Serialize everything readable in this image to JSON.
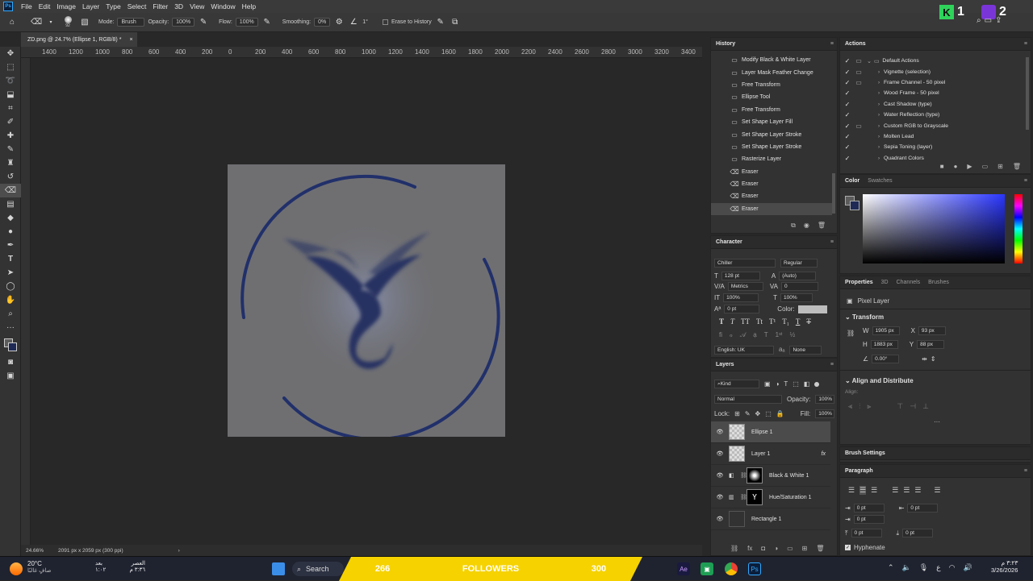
{
  "app": {
    "logo": "Ps"
  },
  "menu": [
    "File",
    "Edit",
    "Image",
    "Layer",
    "Type",
    "Select",
    "Filter",
    "3D",
    "View",
    "Window",
    "Help"
  ],
  "options": {
    "brush_size": "92",
    "mode_label": "Mode:",
    "mode_value": "Brush",
    "opacity_label": "Opacity:",
    "opacity_value": "100%",
    "flow_label": "Flow:",
    "flow_value": "100%",
    "smoothing_label": "Smoothing:",
    "smoothing_value": "0%",
    "angle_value": "1°",
    "erase_history": "Erase to History"
  },
  "overlay": {
    "score_left": "1",
    "score_right": "2"
  },
  "document": {
    "tab_title": "ZD.png @ 24.7% (Ellipse 1, RGB/8) *",
    "tab_close": "×"
  },
  "ruler_labels": [
    "1400",
    "1200",
    "1000",
    "800",
    "600",
    "400",
    "200",
    "0",
    "200",
    "400",
    "600",
    "800",
    "1000",
    "1200",
    "1400",
    "1600",
    "1800",
    "2000",
    "2200",
    "2400",
    "2600",
    "2800",
    "3000",
    "3200",
    "3400"
  ],
  "status": {
    "zoom": "24.66%",
    "doc_size": "2091 px x 2059 px (300 ppi)",
    "arrow": "›"
  },
  "history": {
    "title": "History",
    "items": [
      "Modify Black & White Layer",
      "Layer Mask Feather Change",
      "Free Transform",
      "Ellipse Tool",
      "Free Transform",
      "Set Shape Layer Fill",
      "Set Shape Layer Stroke",
      "Set Shape Layer Stroke",
      "Rasterize Layer",
      "Eraser",
      "Eraser",
      "Eraser",
      "Eraser"
    ]
  },
  "actions": {
    "title": "Actions",
    "items": [
      "Default Actions",
      "Vignette (selection)",
      "Frame Channel - 50 pixel",
      "Wood Frame - 50 pixel",
      "Cast Shadow (type)",
      "Water Reflection (type)",
      "Custom RGB to Grayscale",
      "Molten Lead",
      "Sepia Toning (layer)",
      "Quadrant Colors"
    ]
  },
  "color": {
    "tab_active": "Color",
    "tab_inactive": "Swatches",
    "hue_top": "#2a36ff"
  },
  "character": {
    "title": "Character",
    "font": "Chiller",
    "style": "Regular",
    "size": "128 pt",
    "leading": "(Auto)",
    "kerning": "Metrics",
    "tracking": "0",
    "vscale": "100%",
    "hscale": "100%",
    "baseline": "0 pt",
    "color_label": "Color:",
    "language": "English: UK",
    "aa": "None"
  },
  "properties": {
    "tabs": [
      "Properties",
      "3D",
      "Channels",
      "Brushes"
    ],
    "kind": "Pixel Layer",
    "transform_label": "Transform",
    "w_label": "W",
    "w": "1905 px",
    "x_label": "X",
    "x": "93 px",
    "h_label": "H",
    "h": "1883 px",
    "y_label": "Y",
    "y": "88 px",
    "angle": "0.00°",
    "align_label": "Align and Distribute",
    "align_sub": "Align:",
    "more": "···"
  },
  "layers": {
    "title": "Layers",
    "kind": "Kind",
    "blend": "Normal",
    "opacity_label": "Opacity:",
    "opacity": "100%",
    "lock_label": "Lock:",
    "fill_label": "Fill:",
    "fill": "100%",
    "fx": "fx",
    "items": [
      "Ellipse 1",
      "Layer 1",
      "Black & White 1",
      "Hue/Saturation 1",
      "Rectangle 1"
    ]
  },
  "brush_settings": {
    "title": "Brush Settings"
  },
  "paragraph": {
    "title": "Paragraph",
    "indent_left": "0 pt",
    "indent_right": "0 pt",
    "first_line": "0 pt",
    "space_before": "0 pt",
    "space_after": "0 pt",
    "hyphenate": "Hyphenate"
  },
  "taskbar": {
    "weather_temp": "20°C",
    "weather_desc": "صافٍ غالبًا",
    "prayer_label": "العصر",
    "prayer_in": "بعد",
    "prayer_time": "٣:٣٦ م",
    "prayer_left": "١:٠٢",
    "search": "Search",
    "banner_left": "266",
    "banner_mid": "FOLLOWERS",
    "banner_right": "300",
    "time": "٣:٢٣ م",
    "date": "3/26/2026",
    "lang": "ع"
  }
}
